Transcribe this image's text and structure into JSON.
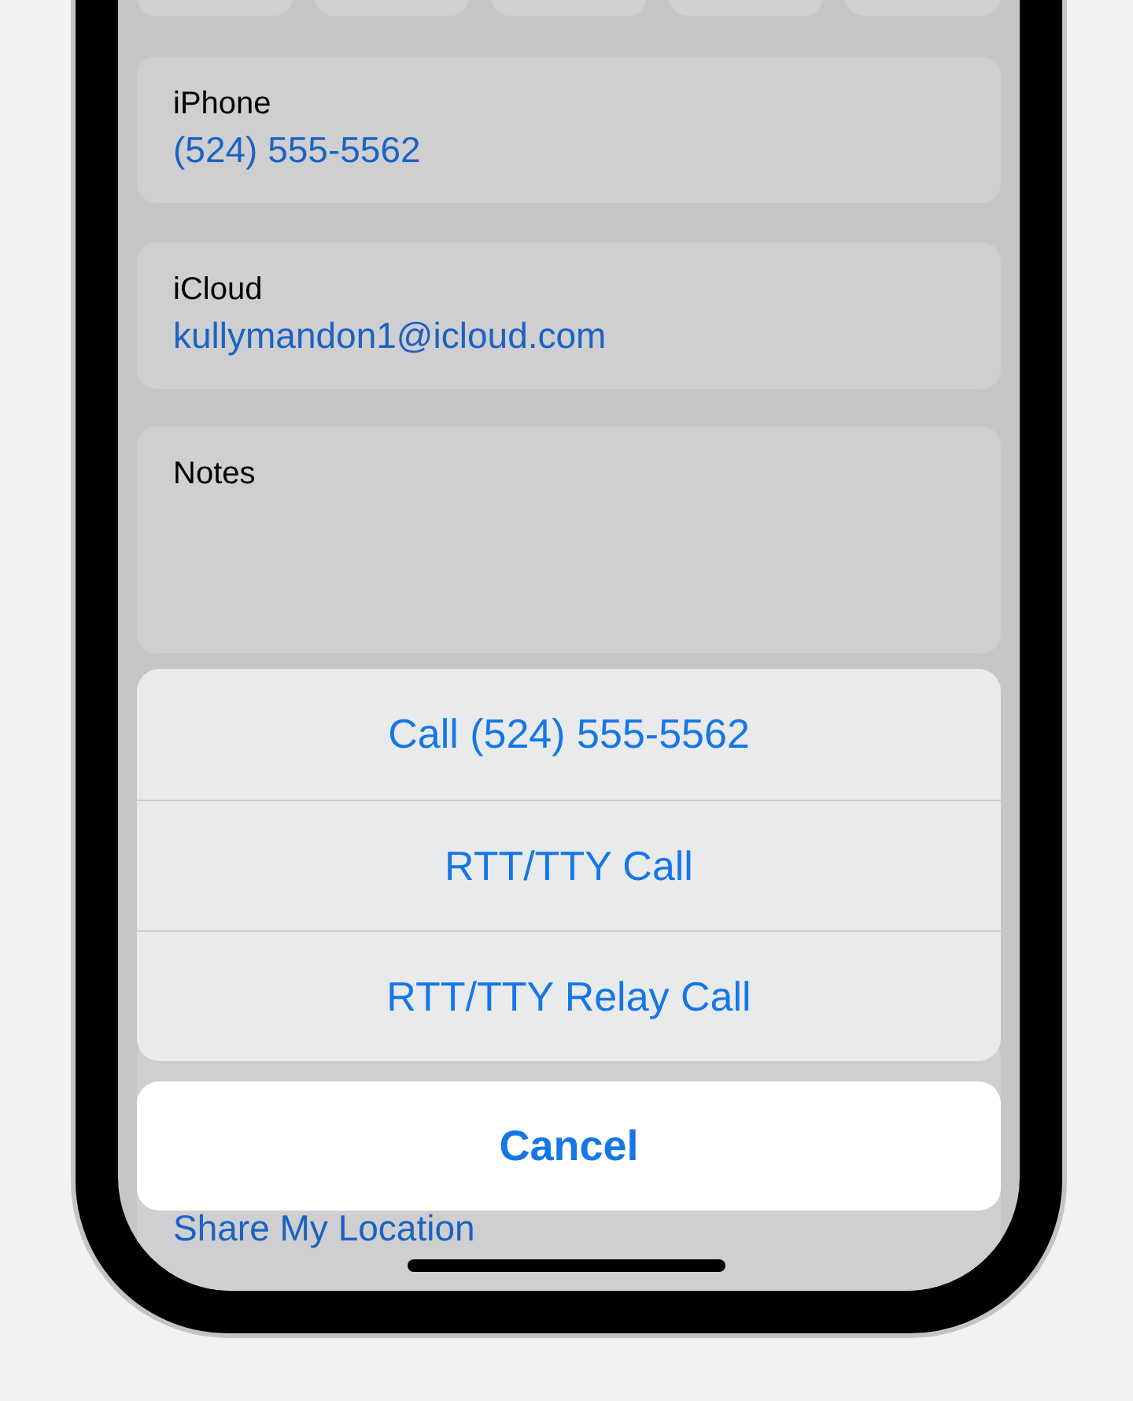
{
  "contact_fields": [
    {
      "kind": "field",
      "label": "iPhone",
      "value": "(524) 555-5562"
    },
    {
      "kind": "field",
      "label": "iCloud",
      "value": "kullymandon1@icloud.com"
    },
    {
      "kind": "notes",
      "label": "Notes"
    }
  ],
  "contact_actions": [
    "Share My Location"
  ],
  "action_sheet": {
    "actions": [
      "Call (524) 555-5562",
      "RTT/TTY Call",
      "RTT/TTY Relay Call"
    ],
    "cancel": "Cancel"
  }
}
